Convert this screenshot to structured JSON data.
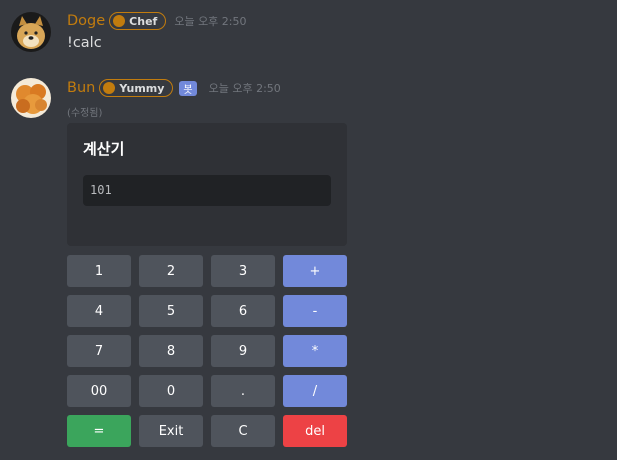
{
  "messages": [
    {
      "username": "Doge",
      "role": "Chef",
      "timestamp": "오늘 오후 2:50",
      "content": "!calc"
    },
    {
      "username": "Bun",
      "role": "Yummy",
      "bot_tag": "봇",
      "timestamp": "오늘 오후 2:50",
      "edited": "(수정됨)",
      "embed": {
        "title": "계산기",
        "display": "101"
      }
    }
  ],
  "buttons": [
    {
      "label": "1",
      "style": "secondary"
    },
    {
      "label": "2",
      "style": "secondary"
    },
    {
      "label": "3",
      "style": "secondary"
    },
    {
      "label": "+",
      "style": "primary"
    },
    {
      "label": "4",
      "style": "secondary"
    },
    {
      "label": "5",
      "style": "secondary"
    },
    {
      "label": "6",
      "style": "secondary"
    },
    {
      "label": "-",
      "style": "primary"
    },
    {
      "label": "7",
      "style": "secondary"
    },
    {
      "label": "8",
      "style": "secondary"
    },
    {
      "label": "9",
      "style": "secondary"
    },
    {
      "label": "*",
      "style": "primary"
    },
    {
      "label": "00",
      "style": "secondary"
    },
    {
      "label": "0",
      "style": "secondary"
    },
    {
      "label": ".",
      "style": "secondary"
    },
    {
      "label": "/",
      "style": "primary"
    },
    {
      "label": "=",
      "style": "success"
    },
    {
      "label": "Exit",
      "style": "secondary"
    },
    {
      "label": "C",
      "style": "secondary"
    },
    {
      "label": "del",
      "style": "danger"
    }
  ],
  "colors": {
    "background": "#36393f",
    "role_color": "#c27c0e",
    "blurple": "#7289da",
    "green": "#3ba55c",
    "red": "#ed4245",
    "grey_button": "#4f545c"
  },
  "icons": {
    "avatar1": "doge-avatar",
    "avatar2": "bun-food-avatar"
  }
}
